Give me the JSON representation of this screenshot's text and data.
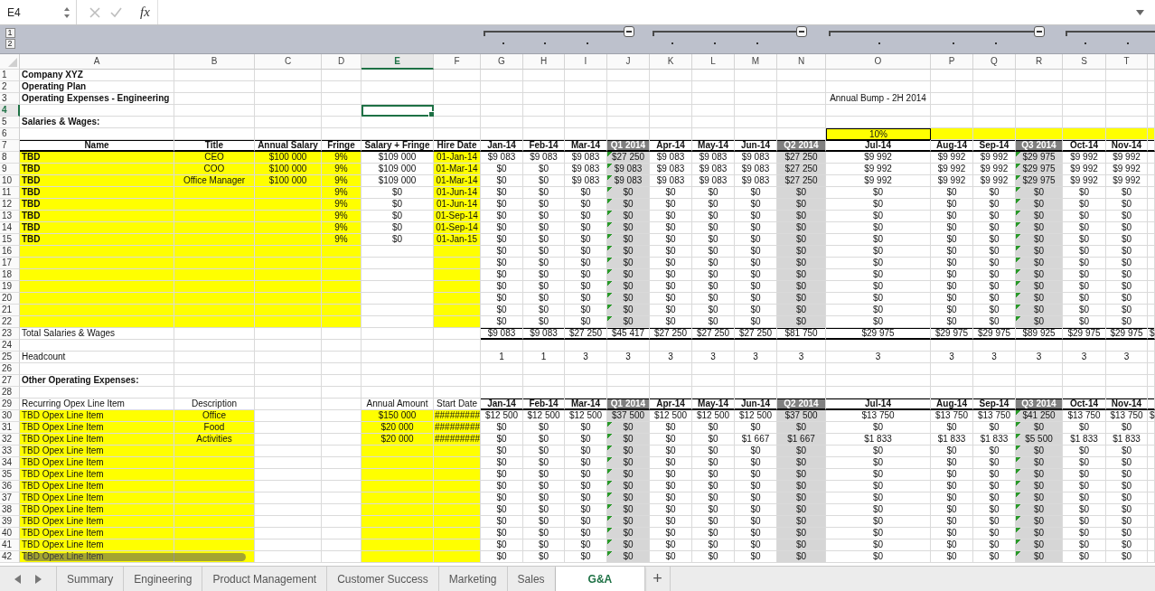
{
  "formula_bar": {
    "name_box": "E4",
    "fx": "fx"
  },
  "outline_levels": [
    "1",
    "2"
  ],
  "columns": [
    {
      "letter": "A",
      "kind": "field",
      "selected": false
    },
    {
      "letter": "B",
      "kind": "field",
      "selected": false
    },
    {
      "letter": "C",
      "kind": "field",
      "selected": false
    },
    {
      "letter": "D",
      "kind": "field",
      "selected": false
    },
    {
      "letter": "E",
      "kind": "field",
      "selected": true
    },
    {
      "letter": "F",
      "kind": "field",
      "selected": false
    },
    {
      "letter": "G",
      "kind": "month",
      "selected": false
    },
    {
      "letter": "H",
      "kind": "month",
      "selected": false
    },
    {
      "letter": "I",
      "kind": "month",
      "selected": false
    },
    {
      "letter": "J",
      "kind": "quarter",
      "selected": false,
      "expanded": true
    },
    {
      "letter": "K",
      "kind": "month",
      "selected": false
    },
    {
      "letter": "L",
      "kind": "month",
      "selected": false
    },
    {
      "letter": "M",
      "kind": "month",
      "selected": false
    },
    {
      "letter": "N",
      "kind": "quarter",
      "selected": false,
      "expanded": true
    },
    {
      "letter": "O",
      "kind": "month",
      "selected": false
    },
    {
      "letter": "P",
      "kind": "month",
      "selected": false
    },
    {
      "letter": "Q",
      "kind": "month",
      "selected": false
    },
    {
      "letter": "R",
      "kind": "quarter",
      "selected": false,
      "expanded": true
    },
    {
      "letter": "S",
      "kind": "month",
      "selected": false
    },
    {
      "letter": "T",
      "kind": "month",
      "selected": false
    },
    {
      "kind": "month",
      "selected": false
    }
  ],
  "rows": [
    {
      "n": "1",
      "kind": "plain",
      "selected": false,
      "cells": {
        "A": "Company XYZ"
      },
      "bold": {
        "A": true
      }
    },
    {
      "n": "2",
      "kind": "plain",
      "selected": false,
      "cells": {
        "A": "Operating Plan"
      },
      "bold": {
        "A": true
      }
    },
    {
      "n": "3",
      "kind": "plain",
      "selected": false,
      "cells": {
        "A": "Operating Expenses - Engineering",
        "O": "Annual Bump - 2H 2014"
      },
      "bold": {
        "A": true
      }
    },
    {
      "n": "4",
      "kind": "plain",
      "selected": true
    },
    {
      "n": "5",
      "kind": "plain",
      "selected": false,
      "cells": {
        "A": "Salaries & Wages:"
      },
      "bold": {
        "A": true
      }
    },
    {
      "n": "6",
      "kind": "plain",
      "selected": false,
      "cells": {
        "O": "10%"
      },
      "yellow": {
        "O": true,
        "P": true,
        "Q": true,
        "R": true,
        "S": true,
        "T": true,
        "U": true
      },
      "boxed": {
        "O": true
      }
    },
    {
      "n": "7",
      "kind": "header",
      "selected": false,
      "cells": {
        "A": "Name",
        "B": "Title",
        "C": "Annual Salary",
        "D": "Fringe",
        "E": "Salary + Fringe",
        "F": "Hire Date",
        "G": "Jan-14",
        "H": "Feb-14",
        "I": "Mar-14",
        "J": "Q1 2014",
        "K": "Apr-14",
        "L": "May-14",
        "M": "Jun-14",
        "N": "Q2 2014",
        "O": "Jul-14",
        "P": "Aug-14",
        "Q": "Sep-14",
        "R": "Q3 2014",
        "S": "Oct-14",
        "T": "Nov-14"
      },
      "bold": {
        "A": true,
        "B": true,
        "C": true,
        "D": true,
        "E": true,
        "F": true,
        "G": true,
        "H": true,
        "I": true,
        "J": true,
        "K": true,
        "L": true,
        "M": true,
        "N": true,
        "O": true,
        "P": true,
        "Q": true,
        "R": true,
        "S": true,
        "T": true
      }
    },
    {
      "n": "8",
      "kind": "data",
      "selected": false,
      "cells": {
        "A": "TBD",
        "B": "CEO",
        "C": "$100 000",
        "D": "9%",
        "E": "$109 000",
        "F": "01-Jan-14",
        "G": "$9 083",
        "H": "$9 083",
        "I": "$9 083",
        "J": "$27 250",
        "K": "$9 083",
        "L": "$9 083",
        "M": "$9 083",
        "N": "$27 250",
        "O": "$9 992",
        "P": "$9 992",
        "Q": "$9 992",
        "R": "$29 975",
        "S": "$9 992",
        "T": "$9 992"
      },
      "bold": {
        "A": true
      },
      "yellow": {
        "A": true,
        "B": true,
        "C": true,
        "D": true,
        "F": true
      },
      "flagged": {
        "J": true,
        "R": true
      }
    },
    {
      "n": "9",
      "kind": "data",
      "selected": false,
      "cells": {
        "A": "TBD",
        "B": "COO",
        "C": "$100 000",
        "D": "9%",
        "E": "$109 000",
        "F": "01-Mar-14",
        "G": "$0",
        "H": "$0",
        "I": "$9 083",
        "J": "$9 083",
        "K": "$9 083",
        "L": "$9 083",
        "M": "$9 083",
        "N": "$27 250",
        "O": "$9 992",
        "P": "$9 992",
        "Q": "$9 992",
        "R": "$29 975",
        "S": "$9 992",
        "T": "$9 992"
      },
      "bold": {
        "A": true
      },
      "yellow": {
        "A": true,
        "B": true,
        "C": true,
        "D": true,
        "F": true
      },
      "flagged": {
        "J": true,
        "R": true
      }
    },
    {
      "n": "10",
      "kind": "data",
      "selected": false,
      "cells": {
        "A": "TBD",
        "B": "Office Manager",
        "C": "$100 000",
        "D": "9%",
        "E": "$109 000",
        "F": "01-Mar-14",
        "G": "$0",
        "H": "$0",
        "I": "$9 083",
        "J": "$9 083",
        "K": "$9 083",
        "L": "$9 083",
        "M": "$9 083",
        "N": "$27 250",
        "O": "$9 992",
        "P": "$9 992",
        "Q": "$9 992",
        "R": "$29 975",
        "S": "$9 992",
        "T": "$9 992"
      },
      "bold": {
        "A": true
      },
      "yellow": {
        "A": true,
        "B": true,
        "C": true,
        "D": true,
        "F": true
      },
      "flagged": {
        "J": true,
        "R": true
      }
    },
    {
      "n": "11",
      "kind": "data",
      "selected": false,
      "cells": {
        "A": "TBD",
        "D": "9%",
        "E": "$0",
        "F": "01-Jun-14",
        "G": "$0",
        "H": "$0",
        "I": "$0",
        "J": "$0",
        "K": "$0",
        "L": "$0",
        "M": "$0",
        "N": "$0",
        "O": "$0",
        "P": "$0",
        "Q": "$0",
        "R": "$0",
        "S": "$0",
        "T": "$0"
      },
      "bold": {
        "A": true
      },
      "yellow": {
        "A": true,
        "B": true,
        "C": true,
        "D": true,
        "F": true
      },
      "flagged": {
        "J": true,
        "R": true
      }
    },
    {
      "n": "12",
      "kind": "data",
      "selected": false,
      "cells": {
        "A": "TBD",
        "D": "9%",
        "E": "$0",
        "F": "01-Jun-14",
        "G": "$0",
        "H": "$0",
        "I": "$0",
        "J": "$0",
        "K": "$0",
        "L": "$0",
        "M": "$0",
        "N": "$0",
        "O": "$0",
        "P": "$0",
        "Q": "$0",
        "R": "$0",
        "S": "$0",
        "T": "$0"
      },
      "bold": {
        "A": true
      },
      "yellow": {
        "A": true,
        "B": true,
        "C": true,
        "D": true,
        "F": true
      },
      "flagged": {
        "J": true,
        "R": true
      }
    },
    {
      "n": "13",
      "kind": "data",
      "selected": false,
      "cells": {
        "A": "TBD",
        "D": "9%",
        "E": "$0",
        "F": "01-Sep-14",
        "G": "$0",
        "H": "$0",
        "I": "$0",
        "J": "$0",
        "K": "$0",
        "L": "$0",
        "M": "$0",
        "N": "$0",
        "O": "$0",
        "P": "$0",
        "Q": "$0",
        "R": "$0",
        "S": "$0",
        "T": "$0"
      },
      "bold": {
        "A": true
      },
      "yellow": {
        "A": true,
        "B": true,
        "C": true,
        "D": true,
        "F": true
      },
      "flagged": {
        "J": true,
        "R": true
      }
    },
    {
      "n": "14",
      "kind": "data",
      "selected": false,
      "cells": {
        "A": "TBD",
        "D": "9%",
        "E": "$0",
        "F": "01-Sep-14",
        "G": "$0",
        "H": "$0",
        "I": "$0",
        "J": "$0",
        "K": "$0",
        "L": "$0",
        "M": "$0",
        "N": "$0",
        "O": "$0",
        "P": "$0",
        "Q": "$0",
        "R": "$0",
        "S": "$0",
        "T": "$0"
      },
      "bold": {
        "A": true
      },
      "yellow": {
        "A": true,
        "B": true,
        "C": true,
        "D": true,
        "F": true
      },
      "flagged": {
        "J": true,
        "R": true
      }
    },
    {
      "n": "15",
      "kind": "data",
      "selected": false,
      "cells": {
        "A": "TBD",
        "D": "9%",
        "E": "$0",
        "F": "01-Jan-15",
        "G": "$0",
        "H": "$0",
        "I": "$0",
        "J": "$0",
        "K": "$0",
        "L": "$0",
        "M": "$0",
        "N": "$0",
        "O": "$0",
        "P": "$0",
        "Q": "$0",
        "R": "$0",
        "S": "$0",
        "T": "$0"
      },
      "bold": {
        "A": true
      },
      "yellow": {
        "A": true,
        "B": true,
        "C": true,
        "D": true,
        "F": true
      },
      "flagged": {
        "J": true,
        "R": true
      }
    },
    {
      "n": "16",
      "kind": "data",
      "selected": false,
      "cells": {
        "G": "$0",
        "H": "$0",
        "I": "$0",
        "J": "$0",
        "K": "$0",
        "L": "$0",
        "M": "$0",
        "N": "$0",
        "O": "$0",
        "P": "$0",
        "Q": "$0",
        "R": "$0",
        "S": "$0",
        "T": "$0"
      },
      "yellow": {
        "A": true,
        "B": true,
        "C": true,
        "D": true,
        "F": true
      },
      "flagged": {
        "J": true,
        "R": true
      }
    },
    {
      "n": "17",
      "kind": "data",
      "selected": false,
      "cells": {
        "G": "$0",
        "H": "$0",
        "I": "$0",
        "J": "$0",
        "K": "$0",
        "L": "$0",
        "M": "$0",
        "N": "$0",
        "O": "$0",
        "P": "$0",
        "Q": "$0",
        "R": "$0",
        "S": "$0",
        "T": "$0"
      },
      "yellow": {
        "A": true,
        "B": true,
        "C": true,
        "D": true,
        "F": true
      },
      "flagged": {
        "J": true,
        "R": true
      }
    },
    {
      "n": "18",
      "kind": "data",
      "selected": false,
      "cells": {
        "G": "$0",
        "H": "$0",
        "I": "$0",
        "J": "$0",
        "K": "$0",
        "L": "$0",
        "M": "$0",
        "N": "$0",
        "O": "$0",
        "P": "$0",
        "Q": "$0",
        "R": "$0",
        "S": "$0",
        "T": "$0"
      },
      "yellow": {
        "A": true,
        "B": true,
        "C": true,
        "D": true,
        "F": true
      },
      "flagged": {
        "J": true,
        "R": true
      }
    },
    {
      "n": "19",
      "kind": "data",
      "selected": false,
      "cells": {
        "G": "$0",
        "H": "$0",
        "I": "$0",
        "J": "$0",
        "K": "$0",
        "L": "$0",
        "M": "$0",
        "N": "$0",
        "O": "$0",
        "P": "$0",
        "Q": "$0",
        "R": "$0",
        "S": "$0",
        "T": "$0"
      },
      "yellow": {
        "A": true,
        "B": true,
        "C": true,
        "D": true,
        "F": true
      },
      "flagged": {
        "J": true,
        "R": true
      }
    },
    {
      "n": "20",
      "kind": "data",
      "selected": false,
      "cells": {
        "G": "$0",
        "H": "$0",
        "I": "$0",
        "J": "$0",
        "K": "$0",
        "L": "$0",
        "M": "$0",
        "N": "$0",
        "O": "$0",
        "P": "$0",
        "Q": "$0",
        "R": "$0",
        "S": "$0",
        "T": "$0"
      },
      "yellow": {
        "A": true,
        "B": true,
        "C": true,
        "D": true,
        "F": true
      },
      "flagged": {
        "J": true,
        "R": true
      }
    },
    {
      "n": "21",
      "kind": "data",
      "selected": false,
      "cells": {
        "G": "$0",
        "H": "$0",
        "I": "$0",
        "J": "$0",
        "K": "$0",
        "L": "$0",
        "M": "$0",
        "N": "$0",
        "O": "$0",
        "P": "$0",
        "Q": "$0",
        "R": "$0",
        "S": "$0",
        "T": "$0"
      },
      "yellow": {
        "A": true,
        "B": true,
        "C": true,
        "D": true,
        "F": true
      },
      "flagged": {
        "J": true,
        "R": true
      }
    },
    {
      "n": "22",
      "kind": "data",
      "selected": false,
      "cells": {
        "G": "$0",
        "H": "$0",
        "I": "$0",
        "J": "$0",
        "K": "$0",
        "L": "$0",
        "M": "$0",
        "N": "$0",
        "O": "$0",
        "P": "$0",
        "Q": "$0",
        "R": "$0",
        "S": "$0",
        "T": "$0"
      },
      "yellow": {
        "A": true,
        "B": true,
        "C": true,
        "D": true,
        "F": true
      },
      "flagged": {
        "J": true,
        "R": true
      }
    },
    {
      "n": "23",
      "kind": "total",
      "selected": false,
      "cells": {
        "A": "Total Salaries & Wages",
        "G": "$9 083",
        "H": "$9 083",
        "I": "$27 250",
        "J": "$45 417",
        "K": "$27 250",
        "L": "$27 250",
        "M": "$27 250",
        "N": "$81 750",
        "O": "$29 975",
        "P": "$29 975",
        "Q": "$29 975",
        "R": "$89 925",
        "S": "$29 975",
        "T": "$29 975",
        "U": "$"
      }
    },
    {
      "n": "24",
      "kind": "plain",
      "selected": false
    },
    {
      "n": "25",
      "kind": "plain",
      "selected": false,
      "cells": {
        "A": "Headcount",
        "G": "1",
        "H": "1",
        "I": "3",
        "J": "3",
        "K": "3",
        "L": "3",
        "M": "3",
        "N": "3",
        "O": "3",
        "P": "3",
        "Q": "3",
        "R": "3",
        "S": "3",
        "T": "3"
      }
    },
    {
      "n": "26",
      "kind": "plain",
      "selected": false
    },
    {
      "n": "27",
      "kind": "plain",
      "selected": false,
      "cells": {
        "A": "Other Operating Expenses:"
      },
      "bold": {
        "A": true
      }
    },
    {
      "n": "28",
      "kind": "plain",
      "selected": false
    },
    {
      "n": "29",
      "kind": "header",
      "selected": false,
      "cells": {
        "A": "Recurring Opex Line Item",
        "B": "Description",
        "E": "Annual Amount",
        "F": "Start Date",
        "G": "Jan-14",
        "H": "Feb-14",
        "I": "Mar-14",
        "J": "Q1 2014",
        "K": "Apr-14",
        "L": "May-14",
        "M": "Jun-14",
        "N": "Q2 2014",
        "O": "Jul-14",
        "P": "Aug-14",
        "Q": "Sep-14",
        "R": "Q3 2014",
        "S": "Oct-14",
        "T": "Nov-14"
      },
      "bold": {
        "G": true,
        "H": true,
        "I": true,
        "J": true,
        "K": true,
        "L": true,
        "M": true,
        "N": true,
        "O": true,
        "P": true,
        "Q": true,
        "R": true,
        "S": true,
        "T": true
      }
    },
    {
      "n": "30",
      "kind": "data",
      "selected": false,
      "cells": {
        "A": "TBD Opex Line Item",
        "B": "Office",
        "E": "$150 000",
        "F": "#########",
        "G": "$12 500",
        "H": "$12 500",
        "I": "$12 500",
        "J": "$37 500",
        "K": "$12 500",
        "L": "$12 500",
        "M": "$12 500",
        "N": "$37 500",
        "O": "$13 750",
        "P": "$13 750",
        "Q": "$13 750",
        "R": "$41 250",
        "S": "$13 750",
        "T": "$13 750",
        "U": "$"
      },
      "yellow": {
        "A": true,
        "B": true,
        "E": true,
        "F": true
      },
      "flagged": {
        "R": true
      }
    },
    {
      "n": "31",
      "kind": "data",
      "selected": false,
      "cells": {
        "A": "TBD Opex Line Item",
        "B": "Food",
        "E": "$20 000",
        "F": "#########",
        "G": "$0",
        "H": "$0",
        "I": "$0",
        "J": "$0",
        "K": "$0",
        "L": "$0",
        "M": "$0",
        "N": "$0",
        "O": "$0",
        "P": "$0",
        "Q": "$0",
        "R": "$0",
        "S": "$0",
        "T": "$0"
      },
      "yellow": {
        "A": true,
        "B": true,
        "E": true,
        "F": true
      },
      "flagged": {
        "J": true,
        "R": true
      }
    },
    {
      "n": "32",
      "kind": "data",
      "selected": false,
      "cells": {
        "A": "TBD Opex Line Item",
        "B": "Activities",
        "E": "$20 000",
        "F": "#########",
        "G": "$0",
        "H": "$0",
        "I": "$0",
        "J": "$0",
        "K": "$0",
        "L": "$0",
        "M": "$1 667",
        "N": "$1 667",
        "O": "$1 833",
        "P": "$1 833",
        "Q": "$1 833",
        "R": "$5 500",
        "S": "$1 833",
        "T": "$1 833"
      },
      "yellow": {
        "A": true,
        "B": true,
        "E": true,
        "F": true
      },
      "flagged": {
        "J": true,
        "R": true
      }
    },
    {
      "n": "33",
      "kind": "data",
      "selected": false,
      "cells": {
        "A": "TBD Opex Line Item",
        "G": "$0",
        "H": "$0",
        "I": "$0",
        "J": "$0",
        "K": "$0",
        "L": "$0",
        "M": "$0",
        "N": "$0",
        "O": "$0",
        "P": "$0",
        "Q": "$0",
        "R": "$0",
        "S": "$0",
        "T": "$0"
      },
      "yellow": {
        "A": true,
        "B": true,
        "E": true,
        "F": true
      },
      "flagged": {
        "J": true,
        "R": true
      }
    },
    {
      "n": "34",
      "kind": "data",
      "selected": false,
      "cells": {
        "A": "TBD Opex Line Item",
        "G": "$0",
        "H": "$0",
        "I": "$0",
        "J": "$0",
        "K": "$0",
        "L": "$0",
        "M": "$0",
        "N": "$0",
        "O": "$0",
        "P": "$0",
        "Q": "$0",
        "R": "$0",
        "S": "$0",
        "T": "$0"
      },
      "yellow": {
        "A": true,
        "B": true,
        "E": true,
        "F": true
      },
      "flagged": {
        "J": true,
        "R": true
      }
    },
    {
      "n": "35",
      "kind": "data",
      "selected": false,
      "cells": {
        "A": "TBD Opex Line Item",
        "G": "$0",
        "H": "$0",
        "I": "$0",
        "J": "$0",
        "K": "$0",
        "L": "$0",
        "M": "$0",
        "N": "$0",
        "O": "$0",
        "P": "$0",
        "Q": "$0",
        "R": "$0",
        "S": "$0",
        "T": "$0"
      },
      "yellow": {
        "A": true,
        "B": true,
        "E": true,
        "F": true
      },
      "flagged": {
        "J": true,
        "R": true
      }
    },
    {
      "n": "36",
      "kind": "data",
      "selected": false,
      "cells": {
        "A": "TBD Opex Line Item",
        "G": "$0",
        "H": "$0",
        "I": "$0",
        "J": "$0",
        "K": "$0",
        "L": "$0",
        "M": "$0",
        "N": "$0",
        "O": "$0",
        "P": "$0",
        "Q": "$0",
        "R": "$0",
        "S": "$0",
        "T": "$0"
      },
      "yellow": {
        "A": true,
        "B": true,
        "E": true,
        "F": true
      },
      "flagged": {
        "J": true,
        "R": true
      }
    },
    {
      "n": "37",
      "kind": "data",
      "selected": false,
      "cells": {
        "A": "TBD Opex Line Item",
        "G": "$0",
        "H": "$0",
        "I": "$0",
        "J": "$0",
        "K": "$0",
        "L": "$0",
        "M": "$0",
        "N": "$0",
        "O": "$0",
        "P": "$0",
        "Q": "$0",
        "R": "$0",
        "S": "$0",
        "T": "$0"
      },
      "yellow": {
        "A": true,
        "B": true,
        "E": true,
        "F": true
      },
      "flagged": {
        "J": true,
        "R": true
      }
    },
    {
      "n": "38",
      "kind": "data",
      "selected": false,
      "cells": {
        "A": "TBD Opex Line Item",
        "G": "$0",
        "H": "$0",
        "I": "$0",
        "J": "$0",
        "K": "$0",
        "L": "$0",
        "M": "$0",
        "N": "$0",
        "O": "$0",
        "P": "$0",
        "Q": "$0",
        "R": "$0",
        "S": "$0",
        "T": "$0"
      },
      "yellow": {
        "A": true,
        "B": true,
        "E": true,
        "F": true
      },
      "flagged": {
        "J": true,
        "R": true
      }
    },
    {
      "n": "39",
      "kind": "data",
      "selected": false,
      "cells": {
        "A": "TBD Opex Line Item",
        "G": "$0",
        "H": "$0",
        "I": "$0",
        "J": "$0",
        "K": "$0",
        "L": "$0",
        "M": "$0",
        "N": "$0",
        "O": "$0",
        "P": "$0",
        "Q": "$0",
        "R": "$0",
        "S": "$0",
        "T": "$0"
      },
      "yellow": {
        "A": true,
        "B": true,
        "E": true,
        "F": true
      },
      "flagged": {
        "J": true,
        "R": true
      }
    },
    {
      "n": "40",
      "kind": "data",
      "selected": false,
      "cells": {
        "A": "TBD Opex Line Item",
        "G": "$0",
        "H": "$0",
        "I": "$0",
        "J": "$0",
        "K": "$0",
        "L": "$0",
        "M": "$0",
        "N": "$0",
        "O": "$0",
        "P": "$0",
        "Q": "$0",
        "R": "$0",
        "S": "$0",
        "T": "$0"
      },
      "yellow": {
        "A": true,
        "B": true,
        "E": true,
        "F": true
      },
      "flagged": {
        "J": true,
        "R": true
      }
    },
    {
      "n": "41",
      "kind": "data",
      "selected": false,
      "cells": {
        "A": "TBD Opex Line Item",
        "G": "$0",
        "H": "$0",
        "I": "$0",
        "J": "$0",
        "K": "$0",
        "L": "$0",
        "M": "$0",
        "N": "$0",
        "O": "$0",
        "P": "$0",
        "Q": "$0",
        "R": "$0",
        "S": "$0",
        "T": "$0"
      },
      "yellow": {
        "A": true,
        "B": true,
        "E": true,
        "F": true
      },
      "flagged": {
        "J": true,
        "R": true
      }
    },
    {
      "n": "42",
      "kind": "data",
      "selected": false,
      "cells": {
        "A": "TBD Opex Line Item",
        "G": "$0",
        "H": "$0",
        "I": "$0",
        "J": "$0",
        "K": "$0",
        "L": "$0",
        "M": "$0",
        "N": "$0",
        "O": "$0",
        "P": "$0",
        "Q": "$0",
        "R": "$0",
        "S": "$0",
        "T": "$0"
      },
      "yellow": {
        "A": true,
        "B": true,
        "E": true,
        "F": true
      },
      "flagged": {
        "J": true,
        "R": true
      }
    }
  ],
  "sheet_tabs": [
    {
      "label": "Summary",
      "selected": false
    },
    {
      "label": "Engineering",
      "selected": false
    },
    {
      "label": "Product Management",
      "selected": false
    },
    {
      "label": "Customer Success",
      "selected": false
    },
    {
      "label": "Marketing",
      "selected": false
    },
    {
      "label": "Sales",
      "selected": false
    },
    {
      "label": "G&A",
      "selected": true
    }
  ],
  "add_sheet": "+"
}
